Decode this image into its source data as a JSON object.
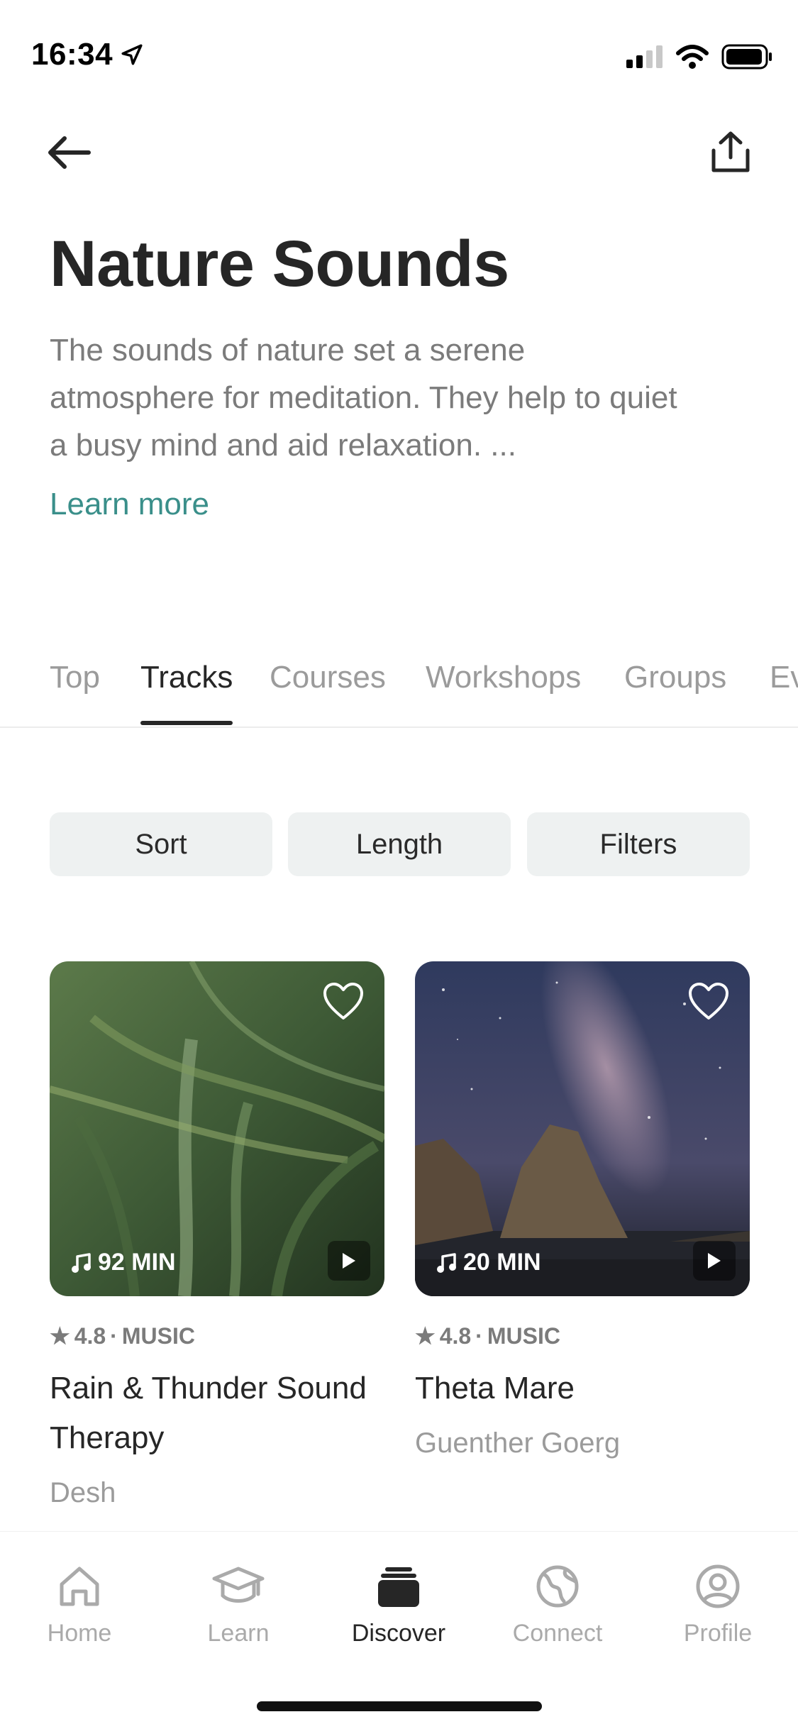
{
  "status_bar": {
    "time": "16:34"
  },
  "header": {
    "title": "Nature Sounds",
    "description": "The sounds of nature set a serene atmosphere for meditation. They help to quiet a busy mind and aid relaxation. ...",
    "learn_more": "Learn more"
  },
  "tabs": [
    {
      "label": "Top"
    },
    {
      "label": "Tracks",
      "active": true
    },
    {
      "label": "Courses"
    },
    {
      "label": "Workshops"
    },
    {
      "label": "Groups"
    },
    {
      "label": "Ev"
    }
  ],
  "filters": {
    "sort": "Sort",
    "length": "Length",
    "filters": "Filters"
  },
  "cards": [
    {
      "duration": "92 MIN",
      "rating": "4.8",
      "type": "MUSIC",
      "title": "Rain & Thunder Sound Therapy",
      "author": "Desh"
    },
    {
      "duration": "20 MIN",
      "rating": "4.8",
      "type": "MUSIC",
      "title": "Theta Mare",
      "author": "Guenther Goerg"
    }
  ],
  "nav": [
    {
      "label": "Home",
      "icon": "home-icon"
    },
    {
      "label": "Learn",
      "icon": "graduation-cap-icon"
    },
    {
      "label": "Discover",
      "icon": "discover-stack-icon",
      "active": true
    },
    {
      "label": "Connect",
      "icon": "globe-icon"
    },
    {
      "label": "Profile",
      "icon": "profile-icon"
    }
  ],
  "colors": {
    "accent": "#3a8f8a",
    "chip_bg": "#eef1f1",
    "text": "#262626",
    "muted": "#9b9b9b"
  }
}
